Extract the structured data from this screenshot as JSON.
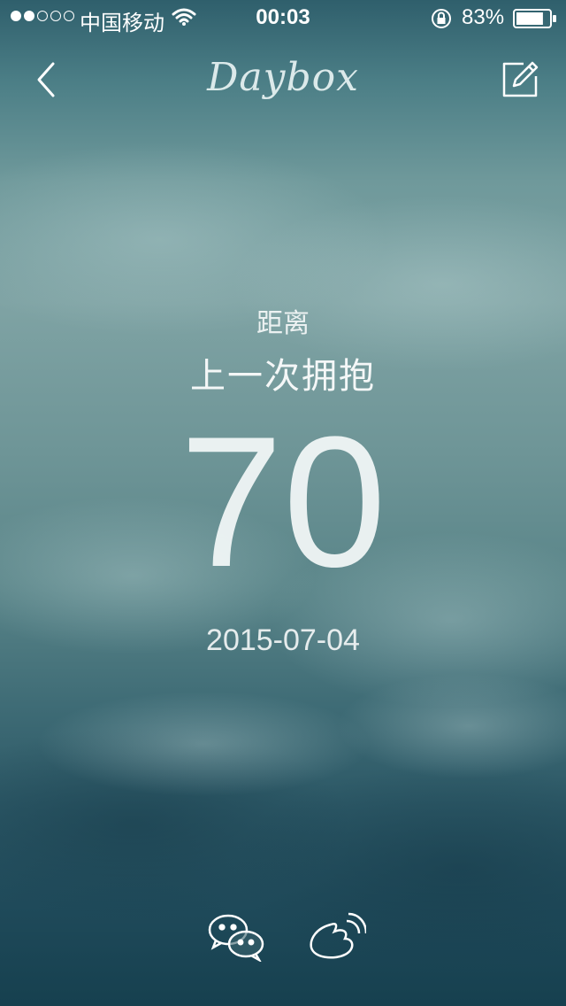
{
  "status_bar": {
    "carrier": "中国移动",
    "time": "00:03",
    "battery_percent": "83%",
    "signal_bars_filled": 2,
    "signal_bars_total": 5,
    "battery_level": 0.83
  },
  "nav": {
    "logo": "Daybox",
    "back_icon": "chevron-left-icon",
    "edit_icon": "edit-icon"
  },
  "event": {
    "prefix": "距离",
    "title": "上一次拥抱",
    "days": "70",
    "date": "2015-07-04"
  },
  "share": {
    "wechat_icon": "wechat-icon",
    "weibo_icon": "weibo-icon"
  }
}
